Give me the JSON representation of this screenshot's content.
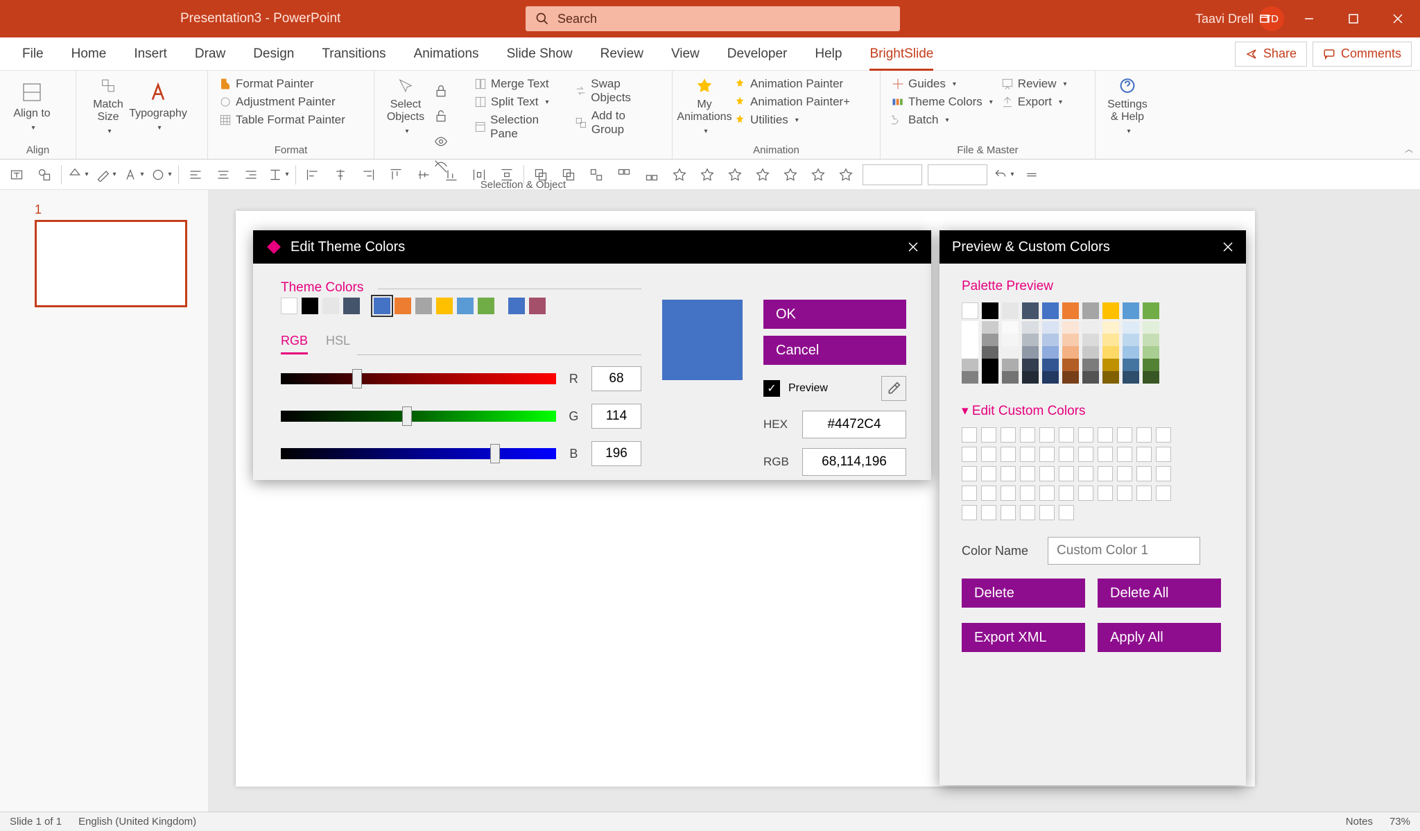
{
  "titlebar": {
    "title": "Presentation3 - PowerPoint",
    "search_placeholder": "Search",
    "user_name": "Taavi Drell",
    "user_initials": "TD"
  },
  "ribbon_tabs": [
    "File",
    "Home",
    "Insert",
    "Draw",
    "Design",
    "Transitions",
    "Animations",
    "Slide Show",
    "Review",
    "View",
    "Developer",
    "Help",
    "BrightSlide"
  ],
  "ribbon_tabs_active": "BrightSlide",
  "ribbon_right": {
    "share": "Share",
    "comments": "Comments"
  },
  "ribbon": {
    "align": {
      "group": "Align",
      "align_to": "Align to",
      "match_size": "Match Size",
      "typography": "Typography"
    },
    "format": {
      "group": "Format",
      "format_painter": "Format Painter",
      "adjustment_painter": "Adjustment Painter",
      "table_format_painter": "Table Format Painter"
    },
    "selobj": {
      "group": "Selection & Object",
      "select_objects": "Select Objects",
      "merge_text": "Merge Text",
      "swap_objects": "Swap Objects",
      "split_text": "Split Text",
      "add_to_group": "Add to Group",
      "selection_pane": "Selection Pane"
    },
    "anim": {
      "group": "Animation",
      "my_anim": "My Animations",
      "anim_painter": "Animation Painter",
      "anim_painter_plus": "Animation Painter+",
      "utilities": "Utilities"
    },
    "filemaster": {
      "group": "File & Master",
      "guides": "Guides",
      "theme_colors": "Theme Colors",
      "batch": "Batch",
      "review": "Review",
      "export": "Export"
    },
    "settings": {
      "label": "Settings & Help"
    }
  },
  "thumb": {
    "num": "1"
  },
  "dlg1": {
    "title": "Edit Theme Colors",
    "theme_colors_h": "Theme Colors",
    "rgb": "RGB",
    "hsl": "HSL",
    "r_label": "R",
    "g_label": "G",
    "b_label": "B",
    "r": "68",
    "g": "114",
    "b": "196",
    "ok": "OK",
    "cancel": "Cancel",
    "preview": "Preview",
    "hex_label": "HEX",
    "hex": "#4472C4",
    "rgb_label": "RGB",
    "rgb_val": "68,114,196",
    "theme_swatches": [
      "#ffffff",
      "#000000",
      "#e7e6e6",
      "#44546a",
      "#4472c4",
      "#ed7d31",
      "#a5a5a5",
      "#ffc000",
      "#5b9bd5",
      "#70ad47",
      "#4472c4",
      "#a5506a"
    ],
    "selected_swatch": 4
  },
  "dlg2": {
    "title": "Preview & Custom Colors",
    "palette_h": "Palette Preview",
    "custom_h": "Edit Custom Colors",
    "color_name_label": "Color Name",
    "color_name_ph": "Custom Color 1",
    "delete": "Delete",
    "delete_all": "Delete All",
    "export_xml": "Export XML",
    "apply_all": "Apply All",
    "palette_base": [
      "#ffffff",
      "#000000",
      "#e7e6e6",
      "#44546a",
      "#4472c4",
      "#ed7d31",
      "#a5a5a5",
      "#ffc000",
      "#5b9bd5",
      "#70ad47"
    ]
  },
  "status": {
    "slide": "Slide 1 of 1",
    "lang": "English (United Kingdom)",
    "notes": "Notes",
    "zoom": "73%"
  }
}
